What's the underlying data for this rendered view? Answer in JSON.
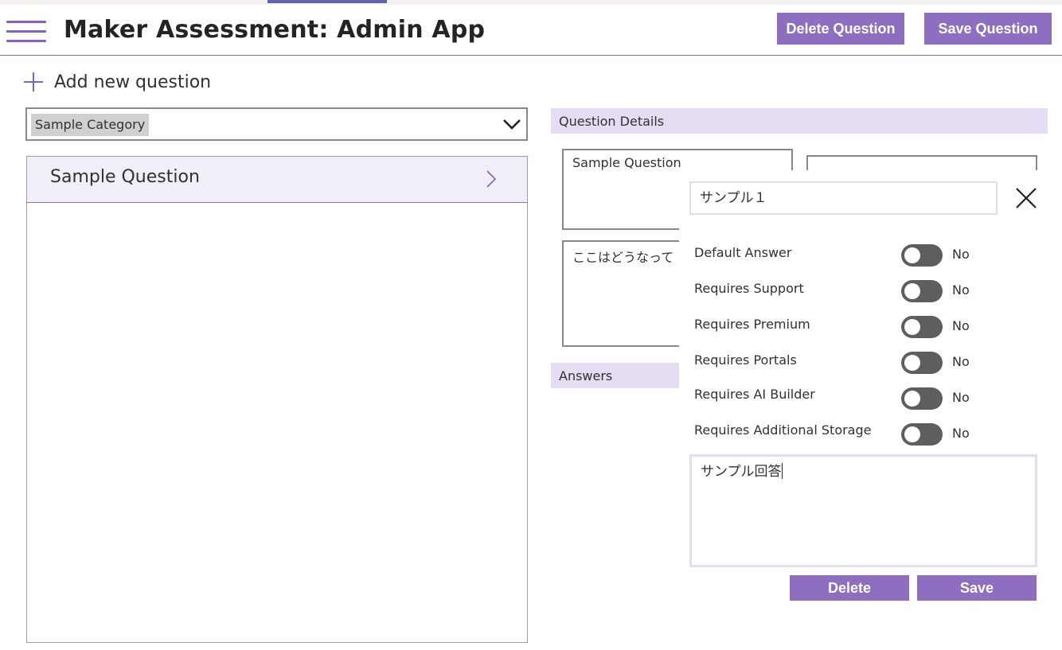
{
  "header": {
    "title": "Maker Assessment: Admin App",
    "delete_question_label": "Delete Question",
    "save_question_label": "Save Question",
    "menu_icon": "hamburger-menu-icon"
  },
  "toolbar": {
    "add_new_question_label": "Add new question",
    "add_icon": "plus-icon"
  },
  "category_select": {
    "selected": "Sample Category"
  },
  "question_list": {
    "items": [
      {
        "label": "Sample Question"
      }
    ]
  },
  "question_details": {
    "section_title": "Question Details",
    "question_text": "Sample Question",
    "description_text": "ここはどうなって",
    "answers_section_title": "Answers"
  },
  "answer_panel": {
    "title_value": "サンプル１",
    "answer_text": "サンプル回答",
    "toggles": [
      {
        "label": "Default Answer",
        "state": "No",
        "on": false
      },
      {
        "label": "Requires Support",
        "state": "No",
        "on": false
      },
      {
        "label": "Requires Premium",
        "state": "No",
        "on": false
      },
      {
        "label": "Requires Portals",
        "state": "No",
        "on": false
      },
      {
        "label": "Requires AI Builder",
        "state": "No",
        "on": false
      },
      {
        "label": "Requires Additional Storage",
        "state": "No",
        "on": false
      }
    ],
    "delete_label": "Delete",
    "save_label": "Save"
  },
  "colors": {
    "accent": "#8d6ec0",
    "section_bar": "#e4ddf3",
    "selected_item": "#f1eef7"
  }
}
